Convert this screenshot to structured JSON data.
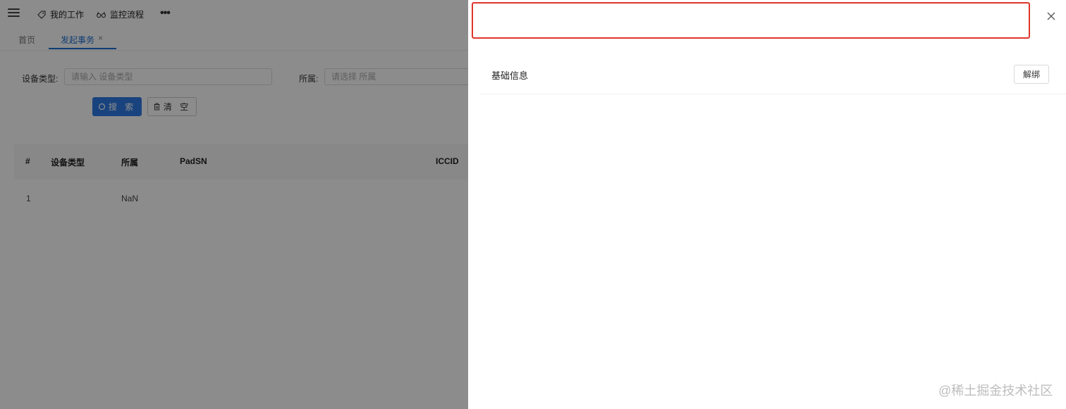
{
  "topbar": {
    "nav_items": [
      {
        "label": "我的工作",
        "icon": "tag-icon"
      },
      {
        "label": "监控流程",
        "icon": "glasses-icon"
      }
    ],
    "more_label": "•••"
  },
  "tabs": [
    {
      "label": "首页",
      "active": false
    },
    {
      "label": "发起事务",
      "active": true,
      "closable": true
    }
  ],
  "tab_close_glyph": "×",
  "search_form": {
    "device_type": {
      "label": "设备类型:",
      "placeholder": "请输入 设备类型"
    },
    "owner": {
      "label": "所属:",
      "placeholder": "请选择 所属"
    },
    "search_button": "搜 索",
    "clear_button": "清 空"
  },
  "table": {
    "columns": [
      "#",
      "设备类型",
      "所属",
      "PadSN",
      "ICCID"
    ],
    "rows": [
      {
        "index": "1",
        "device_type": "",
        "owner": "NaN",
        "padsn": "",
        "iccid": ""
      }
    ]
  },
  "drawer": {
    "title": "",
    "close_glyph": "×",
    "section_title": "基础信息",
    "unbind_button": "解绑"
  },
  "watermark": "@稀土掘金技术社区",
  "colors": {
    "accent": "#2f7ae5",
    "highlight_border": "#e0352b",
    "overlay": "rgba(0,0,0,0.45)"
  }
}
